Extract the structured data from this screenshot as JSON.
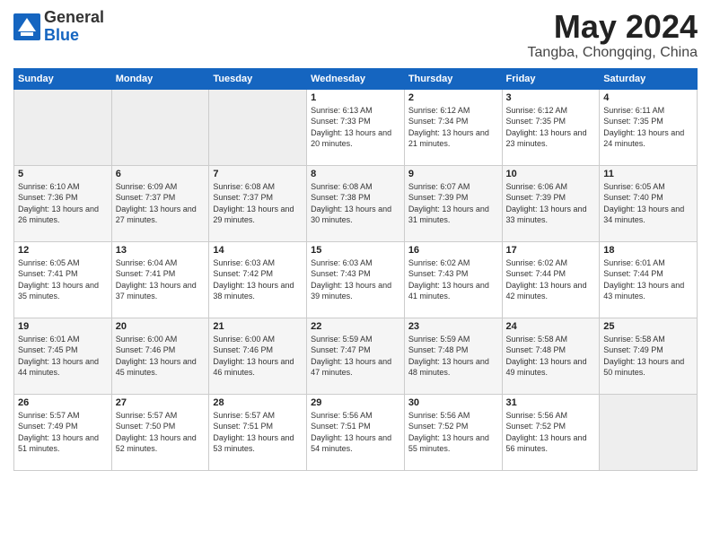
{
  "logo": {
    "general": "General",
    "blue": "Blue"
  },
  "title": {
    "month_year": "May 2024",
    "location": "Tangba, Chongqing, China"
  },
  "days_of_week": [
    "Sunday",
    "Monday",
    "Tuesday",
    "Wednesday",
    "Thursday",
    "Friday",
    "Saturday"
  ],
  "weeks": [
    [
      {
        "day": "",
        "empty": true
      },
      {
        "day": "",
        "empty": true
      },
      {
        "day": "",
        "empty": true
      },
      {
        "day": "1",
        "sunrise": "6:13 AM",
        "sunset": "7:33 PM",
        "daylight": "13 hours and 20 minutes."
      },
      {
        "day": "2",
        "sunrise": "6:12 AM",
        "sunset": "7:34 PM",
        "daylight": "13 hours and 21 minutes."
      },
      {
        "day": "3",
        "sunrise": "6:12 AM",
        "sunset": "7:35 PM",
        "daylight": "13 hours and 23 minutes."
      },
      {
        "day": "4",
        "sunrise": "6:11 AM",
        "sunset": "7:35 PM",
        "daylight": "13 hours and 24 minutes."
      }
    ],
    [
      {
        "day": "5",
        "sunrise": "6:10 AM",
        "sunset": "7:36 PM",
        "daylight": "13 hours and 26 minutes."
      },
      {
        "day": "6",
        "sunrise": "6:09 AM",
        "sunset": "7:37 PM",
        "daylight": "13 hours and 27 minutes."
      },
      {
        "day": "7",
        "sunrise": "6:08 AM",
        "sunset": "7:37 PM",
        "daylight": "13 hours and 29 minutes."
      },
      {
        "day": "8",
        "sunrise": "6:08 AM",
        "sunset": "7:38 PM",
        "daylight": "13 hours and 30 minutes."
      },
      {
        "day": "9",
        "sunrise": "6:07 AM",
        "sunset": "7:39 PM",
        "daylight": "13 hours and 31 minutes."
      },
      {
        "day": "10",
        "sunrise": "6:06 AM",
        "sunset": "7:39 PM",
        "daylight": "13 hours and 33 minutes."
      },
      {
        "day": "11",
        "sunrise": "6:05 AM",
        "sunset": "7:40 PM",
        "daylight": "13 hours and 34 minutes."
      }
    ],
    [
      {
        "day": "12",
        "sunrise": "6:05 AM",
        "sunset": "7:41 PM",
        "daylight": "13 hours and 35 minutes."
      },
      {
        "day": "13",
        "sunrise": "6:04 AM",
        "sunset": "7:41 PM",
        "daylight": "13 hours and 37 minutes."
      },
      {
        "day": "14",
        "sunrise": "6:03 AM",
        "sunset": "7:42 PM",
        "daylight": "13 hours and 38 minutes."
      },
      {
        "day": "15",
        "sunrise": "6:03 AM",
        "sunset": "7:43 PM",
        "daylight": "13 hours and 39 minutes."
      },
      {
        "day": "16",
        "sunrise": "6:02 AM",
        "sunset": "7:43 PM",
        "daylight": "13 hours and 41 minutes."
      },
      {
        "day": "17",
        "sunrise": "6:02 AM",
        "sunset": "7:44 PM",
        "daylight": "13 hours and 42 minutes."
      },
      {
        "day": "18",
        "sunrise": "6:01 AM",
        "sunset": "7:44 PM",
        "daylight": "13 hours and 43 minutes."
      }
    ],
    [
      {
        "day": "19",
        "sunrise": "6:01 AM",
        "sunset": "7:45 PM",
        "daylight": "13 hours and 44 minutes."
      },
      {
        "day": "20",
        "sunrise": "6:00 AM",
        "sunset": "7:46 PM",
        "daylight": "13 hours and 45 minutes."
      },
      {
        "day": "21",
        "sunrise": "6:00 AM",
        "sunset": "7:46 PM",
        "daylight": "13 hours and 46 minutes."
      },
      {
        "day": "22",
        "sunrise": "5:59 AM",
        "sunset": "7:47 PM",
        "daylight": "13 hours and 47 minutes."
      },
      {
        "day": "23",
        "sunrise": "5:59 AM",
        "sunset": "7:48 PM",
        "daylight": "13 hours and 48 minutes."
      },
      {
        "day": "24",
        "sunrise": "5:58 AM",
        "sunset": "7:48 PM",
        "daylight": "13 hours and 49 minutes."
      },
      {
        "day": "25",
        "sunrise": "5:58 AM",
        "sunset": "7:49 PM",
        "daylight": "13 hours and 50 minutes."
      }
    ],
    [
      {
        "day": "26",
        "sunrise": "5:57 AM",
        "sunset": "7:49 PM",
        "daylight": "13 hours and 51 minutes."
      },
      {
        "day": "27",
        "sunrise": "5:57 AM",
        "sunset": "7:50 PM",
        "daylight": "13 hours and 52 minutes."
      },
      {
        "day": "28",
        "sunrise": "5:57 AM",
        "sunset": "7:51 PM",
        "daylight": "13 hours and 53 minutes."
      },
      {
        "day": "29",
        "sunrise": "5:56 AM",
        "sunset": "7:51 PM",
        "daylight": "13 hours and 54 minutes."
      },
      {
        "day": "30",
        "sunrise": "5:56 AM",
        "sunset": "7:52 PM",
        "daylight": "13 hours and 55 minutes."
      },
      {
        "day": "31",
        "sunrise": "5:56 AM",
        "sunset": "7:52 PM",
        "daylight": "13 hours and 56 minutes."
      },
      {
        "day": "",
        "empty": true
      }
    ]
  ]
}
